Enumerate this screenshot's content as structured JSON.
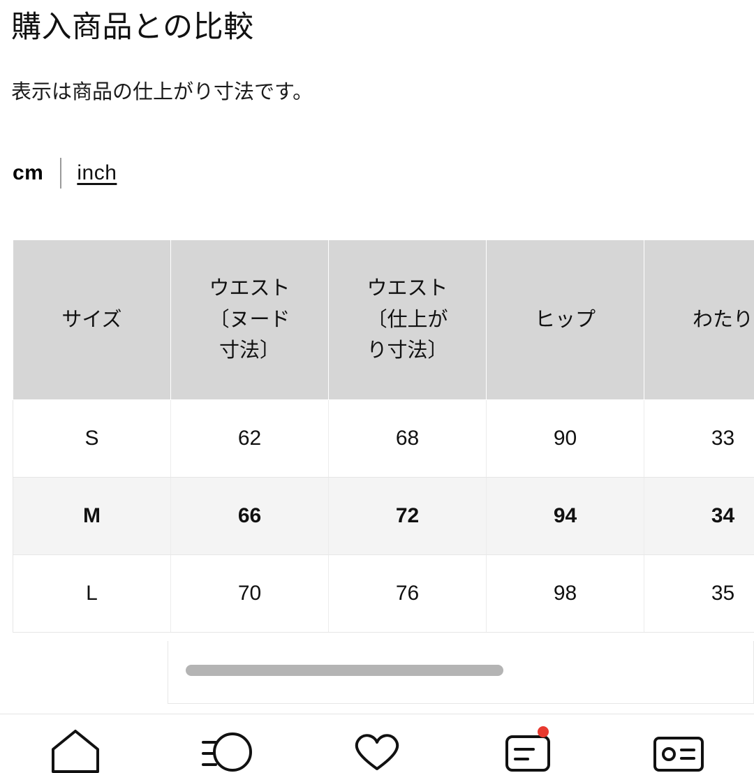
{
  "header": {
    "title": "購入商品との比較",
    "subtitle": "表示は商品の仕上がり寸法です。"
  },
  "unit_toggle": {
    "selected": "cm",
    "cm_label": "cm",
    "inch_label": "inch"
  },
  "table": {
    "columns": [
      "サイズ",
      "ウエスト〔ヌード寸法〕",
      "ウエスト〔仕上がり寸法〕",
      "ヒップ",
      "わたり",
      ""
    ],
    "column_lines": [
      [
        "サイズ"
      ],
      [
        "ウエスト",
        "〔ヌード",
        "寸法〕"
      ],
      [
        "ウエスト",
        "〔仕上が",
        "り寸法〕"
      ],
      [
        "ヒップ"
      ],
      [
        "わたり"
      ],
      [
        ""
      ]
    ],
    "rows": [
      {
        "size": "S",
        "waist_nude": "62",
        "waist_finished": "68",
        "hip": "90",
        "thigh": "33",
        "extra": "",
        "highlight": false
      },
      {
        "size": "M",
        "waist_nude": "66",
        "waist_finished": "72",
        "hip": "94",
        "thigh": "34",
        "extra": "",
        "highlight": true
      },
      {
        "size": "L",
        "waist_nude": "70",
        "waist_finished": "76",
        "hip": "98",
        "thigh": "35",
        "extra": "",
        "highlight": false
      }
    ]
  },
  "scrollbar": {
    "orientation": "horizontal",
    "position_pct": 3
  },
  "bottom_nav": {
    "items": [
      {
        "name": "home",
        "icon": "home-icon",
        "badge": false
      },
      {
        "name": "search",
        "icon": "search-icon",
        "badge": false
      },
      {
        "name": "favorites",
        "icon": "heart-icon",
        "badge": false
      },
      {
        "name": "orders",
        "icon": "receipt-icon",
        "badge": true
      },
      {
        "name": "membership",
        "icon": "member-card-icon",
        "badge": false
      }
    ]
  },
  "colors": {
    "header_bg": "#d6d6d6",
    "row_highlight_bg": "#f4f4f4",
    "badge": "#e8392f",
    "scroll_thumb": "#b4b4b4",
    "text": "#111111"
  }
}
